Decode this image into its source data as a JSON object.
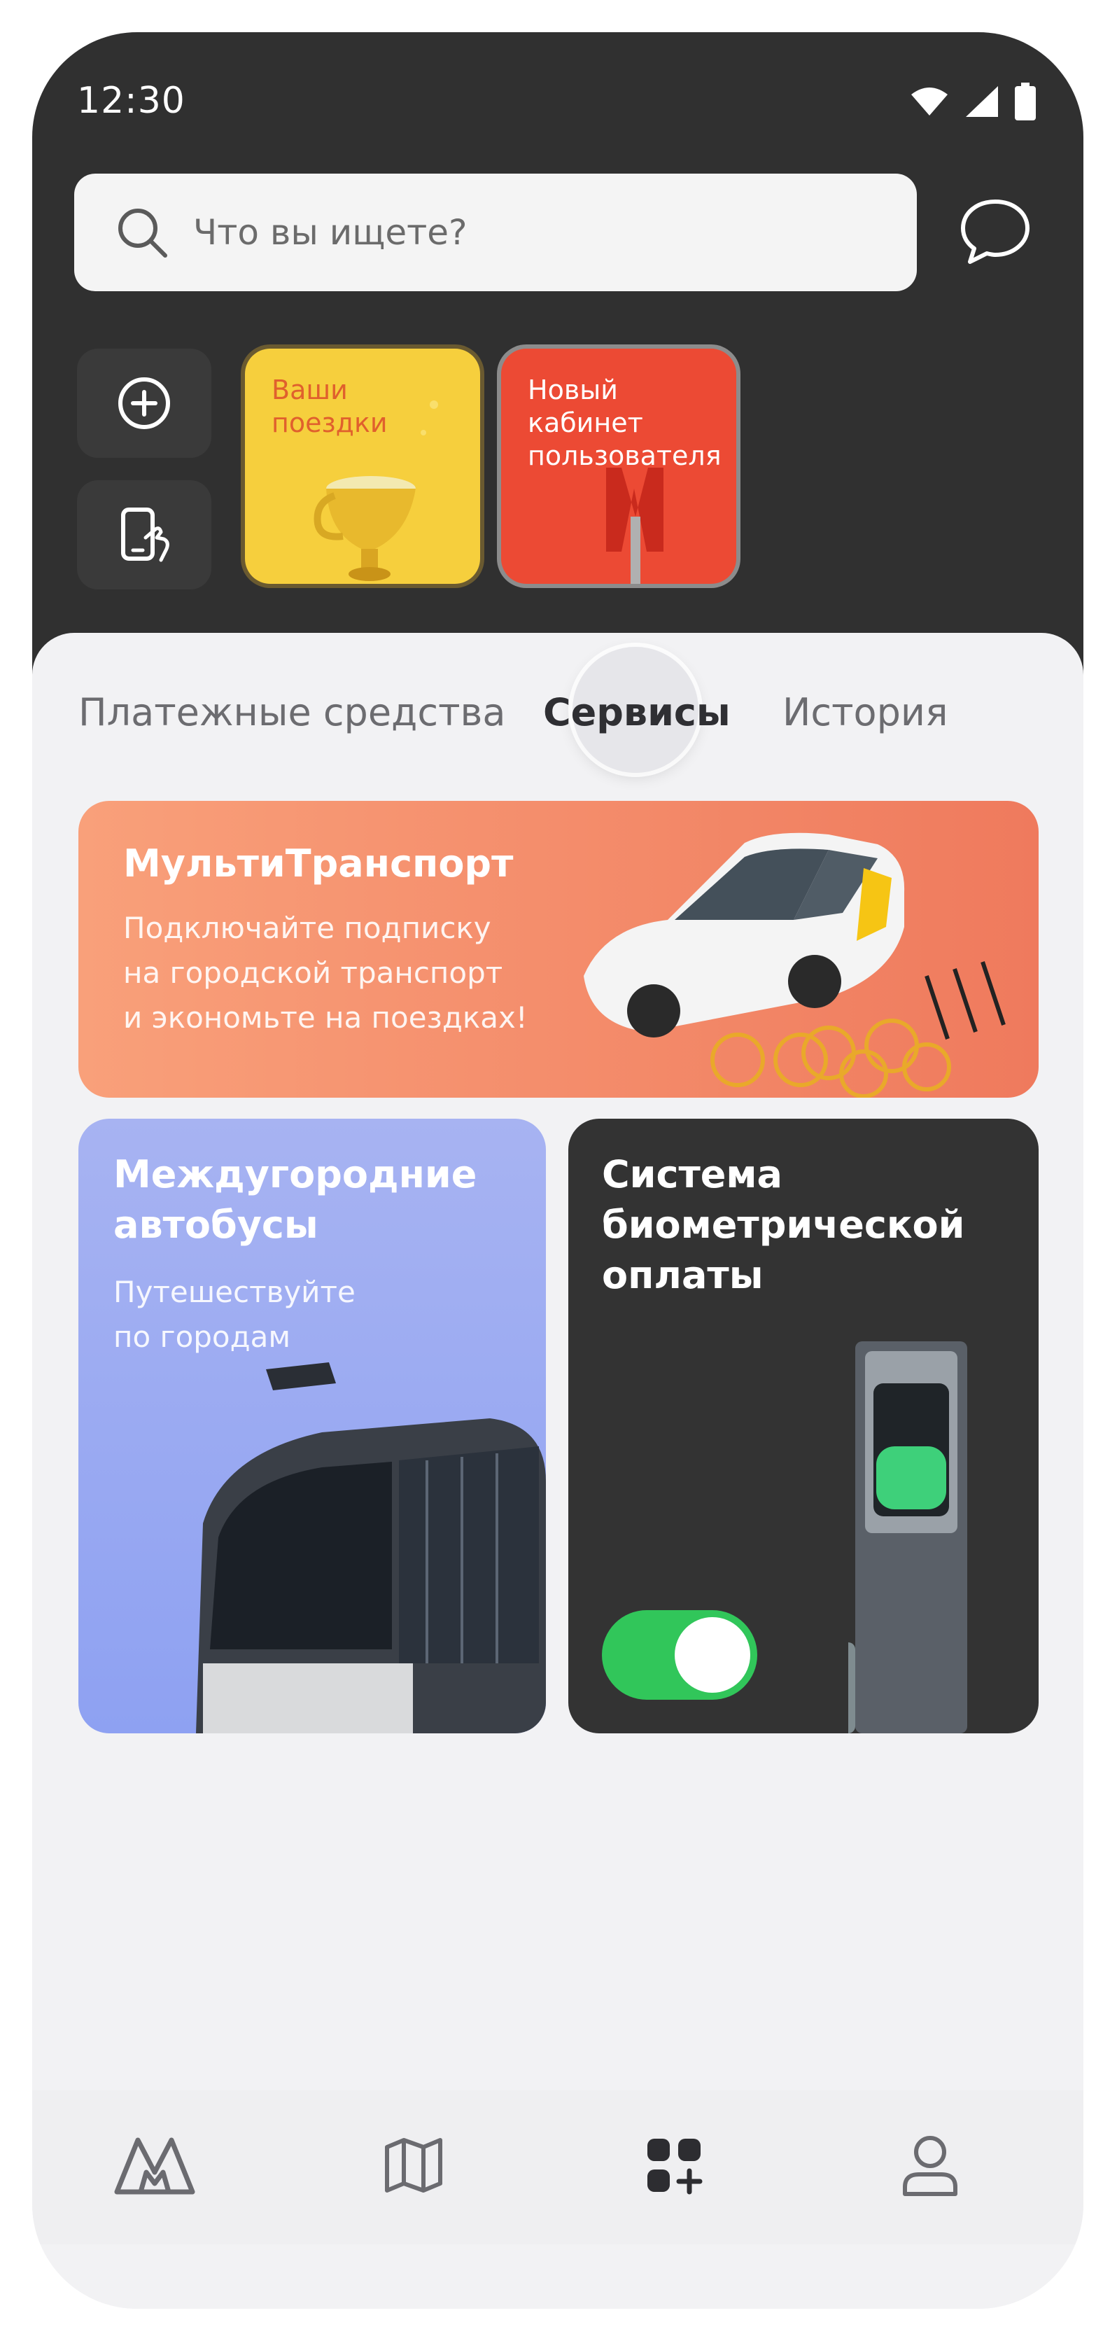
{
  "status_bar": {
    "time": "12:30"
  },
  "search": {
    "placeholder": "Что вы ищете?"
  },
  "stories": [
    {
      "label": "Ваши\nпоездки"
    },
    {
      "label": "Новый\nкабинет\nпользователя"
    }
  ],
  "tabs": [
    {
      "label": "Платежные средства",
      "active": false
    },
    {
      "label": "Сервисы",
      "active": true
    },
    {
      "label": "История",
      "active": false
    }
  ],
  "cards": {
    "multitransport": {
      "title": "МультиТранспорт",
      "subtitle_lines": [
        "Подключайте подписку",
        "на  городской транспорт",
        "и экономьте на поездках!"
      ]
    },
    "buses": {
      "title_lines": [
        "Междугородние",
        "автобусы"
      ],
      "subtitle_lines": [
        "Путешествуйте",
        "по городам"
      ]
    },
    "biometric": {
      "title_lines": [
        "Система",
        "биометрической",
        "оплаты"
      ],
      "toggle_on": true
    }
  },
  "bottom_nav": {
    "items": [
      {
        "icon": "metro-logo-icon",
        "active": false
      },
      {
        "icon": "map-icon",
        "active": false
      },
      {
        "icon": "services-grid-icon",
        "active": true
      },
      {
        "icon": "profile-icon",
        "active": false
      }
    ]
  },
  "colors": {
    "header_bg": "#303030",
    "sheet_bg": "#f2f2f4",
    "multitransport_gradient": [
      "#f9a07a",
      "#ef7a5d"
    ],
    "buses_gradient": [
      "#a7b3f2",
      "#8ea1f2"
    ],
    "biometric_bg": "#333333",
    "toggle_green": "#31c65a",
    "story_yellow": "#f6cf3d",
    "story_red": "#ec4a34"
  }
}
